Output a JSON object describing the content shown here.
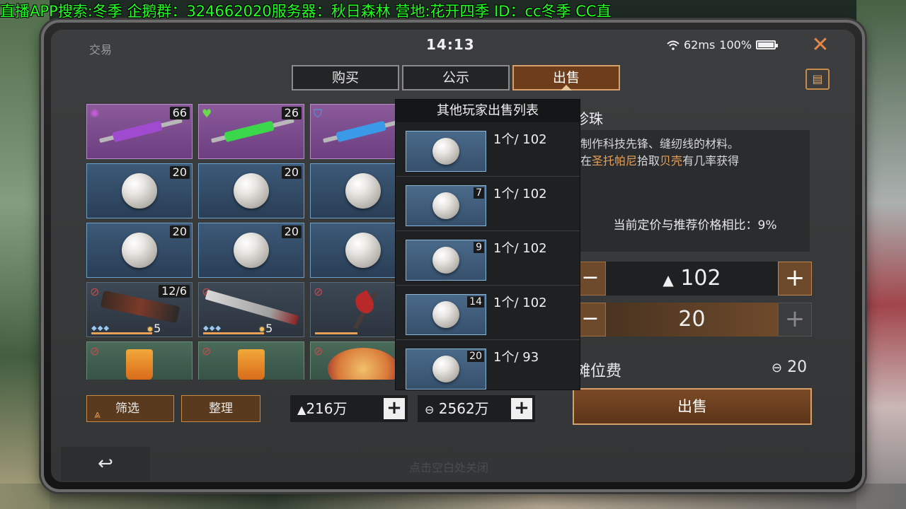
{
  "marquee": "直播APP搜索:冬季 企鹅群：324662020服务器：秋日森林 营地:花开四季 ID：cc冬季  CC直",
  "status": {
    "title": "交易",
    "time": "14:13",
    "ping": "62ms",
    "battery": "100%"
  },
  "tabs": [
    {
      "label": "购买",
      "active": false
    },
    {
      "label": "公示",
      "active": false
    },
    {
      "label": "出售",
      "active": true
    }
  ],
  "grid": {
    "row1": [
      {
        "count": "66"
      },
      {
        "count": "26"
      },
      {
        "count": ""
      }
    ],
    "row2": [
      {
        "count": "20"
      },
      {
        "count": "20"
      }
    ],
    "row3": [
      {
        "count": "20"
      },
      {
        "count": "20"
      }
    ],
    "row4": [
      {
        "count": "12/6",
        "level": "5"
      },
      {
        "level": "5"
      }
    ]
  },
  "popup": {
    "title": "其他玩家出售列表",
    "listings": [
      {
        "qty": "",
        "price": "1个/ 102"
      },
      {
        "qty": "7",
        "price": "1个/ 102"
      },
      {
        "qty": "9",
        "price": "1个/ 102"
      },
      {
        "qty": "14",
        "price": "1个/ 102"
      },
      {
        "qty": "20",
        "price": "1个/ 93"
      }
    ]
  },
  "detail": {
    "name": "珍珠",
    "desc_line1": "制作科技先锋、缝纫线的材料。",
    "desc_line2_pre": "在",
    "desc_place": "圣托帕尼",
    "desc_mid": "拾取",
    "desc_item": "贝壳",
    "desc_post": "有几率获得",
    "ratio": "当前定价与推荐价格相比：9%",
    "price": "102",
    "quantity": "20",
    "fee_label": "摊位费",
    "fee_value": "20",
    "sell_label": "出售"
  },
  "bottom": {
    "filter_label": "筛选",
    "sort_label": "整理",
    "currency1": "216万",
    "currency2": "2562万",
    "tap_hint": "点击空白处关闭"
  },
  "colors": {
    "accent": "#e8a056",
    "marquee": "#22ff22",
    "active_tab": "#6e3e1c"
  }
}
